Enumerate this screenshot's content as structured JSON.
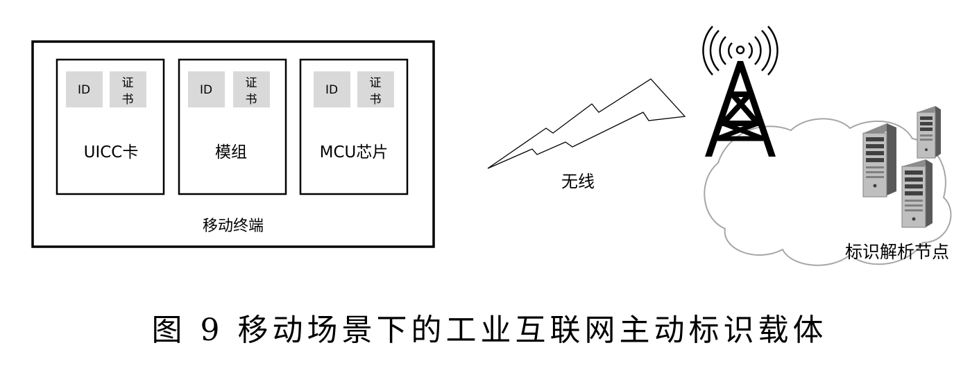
{
  "terminal": {
    "label": "移动终端",
    "components": [
      {
        "name": "UICC卡",
        "id_label": "ID",
        "cert_label": [
          "证",
          "书"
        ]
      },
      {
        "name": "模组",
        "id_label": "ID",
        "cert_label": [
          "证",
          "书"
        ]
      },
      {
        "name": "MCU芯片",
        "id_label": "ID",
        "cert_label": [
          "证",
          "书"
        ]
      }
    ]
  },
  "wireless_label": "无线",
  "node_label": "标识解析节点",
  "caption": "图 9 移动场景下的工业互联网主动标识载体",
  "icons": [
    "signal-tower-icon",
    "cloud-icon",
    "server-icon"
  ],
  "colors": {
    "chip": "#d9d9d9",
    "cloud_stroke": "#a6a6a6",
    "line": "#000000"
  }
}
